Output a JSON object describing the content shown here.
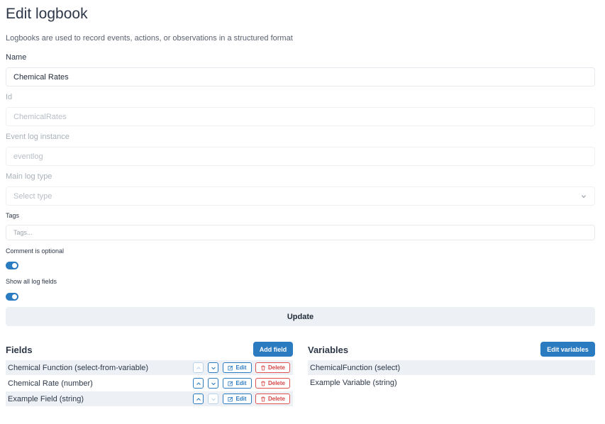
{
  "page": {
    "title": "Edit logbook",
    "description": "Logbooks are used to record events, actions, or observations in a structured format"
  },
  "form": {
    "name_label": "Name",
    "name_value": "Chemical Rates",
    "id_label": "Id",
    "id_value": "ChemicalRates",
    "instance_label": "Event log instance",
    "instance_value": "eventlog",
    "type_label": "Main log type",
    "type_placeholder": "Select type",
    "tags_label": "Tags",
    "tags_placeholder": "Tags...",
    "comment_label": "Comment is optional",
    "comment_on": true,
    "show_all_label": "Show all log fields",
    "show_all_on": true,
    "update_label": "Update"
  },
  "fields_section": {
    "title": "Fields",
    "add_label": "Add field",
    "edit_label": "Edit",
    "delete_label": "Delete",
    "items": [
      {
        "name": "Chemical Function (select-from-variable)"
      },
      {
        "name": "Chemical Rate (number)"
      },
      {
        "name": "Example Field (string)"
      }
    ]
  },
  "variables_section": {
    "title": "Variables",
    "edit_label": "Edit variables",
    "items": [
      {
        "name": "ChemicalFunction (select)"
      },
      {
        "name": "Example Variable (string)"
      }
    ]
  },
  "colors": {
    "accent": "#2b7bc1",
    "danger": "#d64545",
    "row_shade": "#edf1f6"
  }
}
